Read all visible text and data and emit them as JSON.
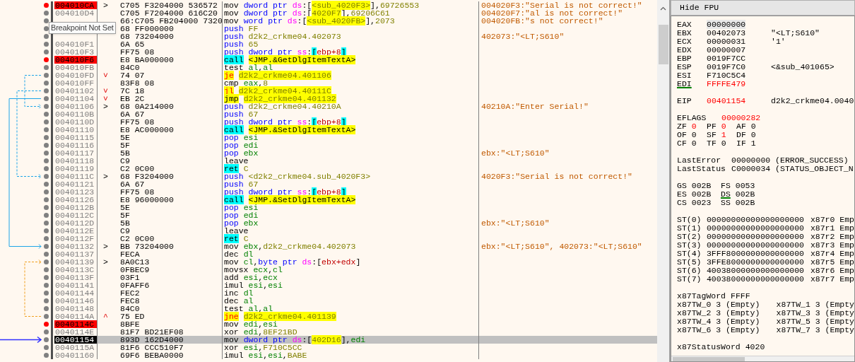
{
  "tooltip": "Breakpoint Not Set",
  "rows": [
    {
      "address": "004010CA",
      "breakpoint": true,
      "current": false,
      "mark": {
        "text": ">",
        "kind": "target"
      },
      "bytes": "C705 F3204000 536572",
      "mnemonic": {
        "text": "mov",
        "kind": "plain"
      },
      "operands": [
        {
          "text": "dword ptr ",
          "kind": "size"
        },
        {
          "text": "ds",
          "kind": "seg"
        },
        {
          "text": ":[",
          "kind": "text"
        },
        {
          "text": "<sub_4020F3>",
          "kind": "labelnum"
        },
        {
          "text": "],",
          "kind": "text"
        },
        {
          "text": "69726553",
          "kind": "num"
        }
      ],
      "comment": "004020F3:\"Serial is not correct!\""
    },
    {
      "address": "004010D4",
      "breakpoint": false,
      "current": false,
      "bytes": "C705 F7204000 616C20",
      "mnemonic": {
        "text": "mov",
        "kind": "plain"
      },
      "operands": [
        {
          "text": "dword ptr ",
          "kind": "size"
        },
        {
          "text": "ds",
          "kind": "seg"
        },
        {
          "text": ":[",
          "kind": "text"
        },
        {
          "text": "4020F7",
          "kind": "labelnum"
        },
        {
          "text": "],",
          "kind": "text"
        },
        {
          "text": "69206C61",
          "kind": "num"
        }
      ],
      "comment": "004020F7:\"al is not correct!\""
    },
    {
      "breakpoint": false,
      "current": false,
      "bytes": "66:C705 FB204000 7320",
      "mnemonic": {
        "text": "mov",
        "kind": "plain"
      },
      "operands": [
        {
          "text": "word ptr ",
          "kind": "size"
        },
        {
          "text": "ds",
          "kind": "seg"
        },
        {
          "text": ":[",
          "kind": "text"
        },
        {
          "text": "<sub_4020FB>",
          "kind": "labelnum"
        },
        {
          "text": "],",
          "kind": "text"
        },
        {
          "text": "2073",
          "kind": "num"
        }
      ],
      "comment": "004020FB:\"s not correct!\""
    },
    {
      "breakpoint": false,
      "current": false,
      "bytes": "68 FF000000",
      "mnemonic": {
        "text": "push",
        "kind": "stack"
      },
      "operands": [
        {
          "text": "FF",
          "kind": "num"
        }
      ]
    },
    {
      "breakpoint": false,
      "current": false,
      "bytes": "68 73204000",
      "mnemonic": {
        "text": "push",
        "kind": "stack"
      },
      "operands": [
        {
          "text": "d2k2_crkme04.402073",
          "kind": "num"
        }
      ],
      "comment": "402073:\"<LT;S610\""
    },
    {
      "address": "004010F1",
      "breakpoint": false,
      "current": false,
      "bytes": "6A 65",
      "mnemonic": {
        "text": "push",
        "kind": "stack"
      },
      "operands": [
        {
          "text": "65",
          "kind": "num"
        }
      ]
    },
    {
      "address": "004010F3",
      "breakpoint": false,
      "current": false,
      "bytes": "FF75 08",
      "mnemonic": {
        "text": "push",
        "kind": "stack"
      },
      "operands": [
        {
          "text": "dword ptr ",
          "kind": "size"
        },
        {
          "text": "ss",
          "kind": "seg"
        },
        {
          "text": ":",
          "kind": "text"
        },
        {
          "text": "[",
          "kind": "hbr"
        },
        {
          "text": "ebp+8",
          "kind": "mem"
        },
        {
          "text": "]",
          "kind": "hbr"
        }
      ]
    },
    {
      "address": "004010F6",
      "breakpoint": true,
      "current": false,
      "bytes": "E8 BA000000",
      "mnemonic": {
        "text": "call",
        "kind": "callret"
      },
      "operands": [
        {
          "text": "<JMP.&GetDlgItemTextA>",
          "kind": "label"
        }
      ]
    },
    {
      "address": "004010FB",
      "breakpoint": false,
      "current": false,
      "bytes": "84C0",
      "mnemonic": {
        "text": "test",
        "kind": "plain"
      },
      "operands": [
        {
          "text": "al",
          "kind": "reg"
        },
        {
          "text": ",",
          "kind": "text"
        },
        {
          "text": "al",
          "kind": "reg"
        }
      ]
    },
    {
      "address": "004010FD",
      "breakpoint": false,
      "current": false,
      "mark": {
        "text": "˅",
        "kind": "jump"
      },
      "bytes": "74 07",
      "mnemonic": {
        "text": "je",
        "kind": "jcc"
      },
      "operands": [
        {
          "text": "d2k2_crkme04.401106",
          "kind": "labelnum"
        }
      ]
    },
    {
      "address": "004010FF",
      "breakpoint": false,
      "current": false,
      "bytes": "83F8 08",
      "mnemonic": {
        "text": "cmp",
        "kind": "plain"
      },
      "operands": [
        {
          "text": "eax",
          "kind": "reg"
        },
        {
          "text": ",",
          "kind": "text"
        },
        {
          "text": "8",
          "kind": "num"
        }
      ]
    },
    {
      "address": "00401102",
      "breakpoint": false,
      "current": false,
      "mark": {
        "text": "˅",
        "kind": "jump"
      },
      "bytes": "7C 18",
      "mnemonic": {
        "text": "jl",
        "kind": "jcc"
      },
      "operands": [
        {
          "text": "d2k2_crkme04.40111C",
          "kind": "labelnum"
        }
      ]
    },
    {
      "address": "00401104",
      "breakpoint": false,
      "current": false,
      "mark": {
        "text": "˅",
        "kind": "jump"
      },
      "bytes": "EB 2C",
      "mnemonic": {
        "text": "jmp",
        "kind": "jmp"
      },
      "operands": [
        {
          "text": "d2k2_crkme04.401132",
          "kind": "labelnum"
        }
      ]
    },
    {
      "address": "00401106",
      "breakpoint": false,
      "current": false,
      "mark": {
        "text": ">",
        "kind": "target"
      },
      "bytes": "68 0A214000",
      "mnemonic": {
        "text": "push",
        "kind": "stack"
      },
      "operands": [
        {
          "text": "d2k2_crkme04.40210A",
          "kind": "num"
        }
      ],
      "comment": "40210A:\"Enter Serial!\""
    },
    {
      "address": "0040110B",
      "breakpoint": false,
      "current": false,
      "bytes": "6A 67",
      "mnemonic": {
        "text": "push",
        "kind": "stack"
      },
      "operands": [
        {
          "text": "67",
          "kind": "num"
        }
      ]
    },
    {
      "address": "0040110D",
      "breakpoint": false,
      "current": false,
      "bytes": "FF75 08",
      "mnemonic": {
        "text": "push",
        "kind": "stack"
      },
      "operands": [
        {
          "text": "dword ptr ",
          "kind": "size"
        },
        {
          "text": "ss",
          "kind": "seg"
        },
        {
          "text": ":",
          "kind": "text"
        },
        {
          "text": "[",
          "kind": "hbr"
        },
        {
          "text": "ebp+8",
          "kind": "mem"
        },
        {
          "text": "]",
          "kind": "hbr"
        }
      ]
    },
    {
      "address": "00401110",
      "breakpoint": false,
      "current": false,
      "bytes": "E8 AC000000",
      "mnemonic": {
        "text": "call",
        "kind": "callret"
      },
      "operands": [
        {
          "text": "<JMP.&SetDlgItemTextA>",
          "kind": "label"
        }
      ]
    },
    {
      "address": "00401115",
      "breakpoint": false,
      "current": false,
      "bytes": "5E",
      "mnemonic": {
        "text": "pop",
        "kind": "stack"
      },
      "operands": [
        {
          "text": "esi",
          "kind": "reg"
        }
      ]
    },
    {
      "address": "00401116",
      "breakpoint": false,
      "current": false,
      "bytes": "5F",
      "mnemonic": {
        "text": "pop",
        "kind": "stack"
      },
      "operands": [
        {
          "text": "edi",
          "kind": "reg"
        }
      ]
    },
    {
      "address": "00401117",
      "breakpoint": false,
      "current": false,
      "bytes": "5B",
      "mnemonic": {
        "text": "pop",
        "kind": "stack"
      },
      "operands": [
        {
          "text": "ebx",
          "kind": "reg"
        }
      ],
      "comment": "ebx:\"<LT;S610\""
    },
    {
      "address": "00401118",
      "breakpoint": false,
      "current": false,
      "bytes": "C9",
      "mnemonic": {
        "text": "leave",
        "kind": "plain"
      },
      "operands": []
    },
    {
      "address": "00401119",
      "breakpoint": false,
      "current": false,
      "bytes": "C2 0C00",
      "mnemonic": {
        "text": "ret",
        "kind": "callret"
      },
      "operands": [
        {
          "text": "C",
          "kind": "num"
        }
      ]
    },
    {
      "address": "0040111C",
      "breakpoint": false,
      "current": false,
      "mark": {
        "text": ">",
        "kind": "target"
      },
      "bytes": "68 F3204000",
      "mnemonic": {
        "text": "push",
        "kind": "stack"
      },
      "operands": [
        {
          "text": "<d2k2_crkme04.sub_4020F3>",
          "kind": "num"
        }
      ],
      "comment": "4020F3:\"Serial is not correct!\""
    },
    {
      "address": "00401121",
      "breakpoint": false,
      "current": false,
      "bytes": "6A 67",
      "mnemonic": {
        "text": "push",
        "kind": "stack"
      },
      "operands": [
        {
          "text": "67",
          "kind": "num"
        }
      ]
    },
    {
      "address": "00401123",
      "breakpoint": false,
      "current": false,
      "bytes": "FF75 08",
      "mnemonic": {
        "text": "push",
        "kind": "stack"
      },
      "operands": [
        {
          "text": "dword ptr ",
          "kind": "size"
        },
        {
          "text": "ss",
          "kind": "seg"
        },
        {
          "text": ":",
          "kind": "text"
        },
        {
          "text": "[",
          "kind": "hbr"
        },
        {
          "text": "ebp+8",
          "kind": "mem"
        },
        {
          "text": "]",
          "kind": "hbr"
        }
      ]
    },
    {
      "address": "00401126",
      "breakpoint": false,
      "current": false,
      "bytes": "E8 96000000",
      "mnemonic": {
        "text": "call",
        "kind": "callret"
      },
      "operands": [
        {
          "text": "<JMP.&SetDlgItemTextA>",
          "kind": "label"
        }
      ]
    },
    {
      "address": "0040112B",
      "breakpoint": false,
      "current": false,
      "bytes": "5E",
      "mnemonic": {
        "text": "pop",
        "kind": "stack"
      },
      "operands": [
        {
          "text": "esi",
          "kind": "reg"
        }
      ]
    },
    {
      "address": "0040112C",
      "breakpoint": false,
      "current": false,
      "bytes": "5F",
      "mnemonic": {
        "text": "pop",
        "kind": "stack"
      },
      "operands": [
        {
          "text": "edi",
          "kind": "reg"
        }
      ]
    },
    {
      "address": "0040112D",
      "breakpoint": false,
      "current": false,
      "bytes": "5B",
      "mnemonic": {
        "text": "pop",
        "kind": "stack"
      },
      "operands": [
        {
          "text": "ebx",
          "kind": "reg"
        }
      ],
      "comment": "ebx:\"<LT;S610\""
    },
    {
      "address": "0040112E",
      "breakpoint": false,
      "current": false,
      "bytes": "C9",
      "mnemonic": {
        "text": "leave",
        "kind": "plain"
      },
      "operands": []
    },
    {
      "address": "0040112F",
      "breakpoint": false,
      "current": false,
      "bytes": "C2 0C00",
      "mnemonic": {
        "text": "ret",
        "kind": "callret"
      },
      "operands": [
        {
          "text": "C",
          "kind": "num"
        }
      ]
    },
    {
      "address": "00401132",
      "breakpoint": false,
      "current": false,
      "mark": {
        "text": ">",
        "kind": "target"
      },
      "bytes": "BB 73204000",
      "mnemonic": {
        "text": "mov",
        "kind": "plain"
      },
      "operands": [
        {
          "text": "ebx",
          "kind": "reg"
        },
        {
          "text": ",",
          "kind": "text"
        },
        {
          "text": "d2k2_crkme04.402073",
          "kind": "num"
        }
      ],
      "comment": "ebx:\"<LT;S610\", 402073:\"<LT;S610\""
    },
    {
      "address": "00401137",
      "breakpoint": false,
      "current": false,
      "bytes": "FECA",
      "mnemonic": {
        "text": "dec",
        "kind": "plain"
      },
      "operands": [
        {
          "text": "dl",
          "kind": "reg"
        }
      ]
    },
    {
      "address": "00401139",
      "breakpoint": false,
      "current": false,
      "mark": {
        "text": ">",
        "kind": "target"
      },
      "bytes": "8A0C13",
      "mnemonic": {
        "text": "mov",
        "kind": "plain"
      },
      "operands": [
        {
          "text": "cl",
          "kind": "reg"
        },
        {
          "text": ",",
          "kind": "text"
        },
        {
          "text": "byte ptr ",
          "kind": "size"
        },
        {
          "text": "ds",
          "kind": "seg"
        },
        {
          "text": ":[",
          "kind": "text"
        },
        {
          "text": "ebx+edx",
          "kind": "mem"
        },
        {
          "text": "]",
          "kind": "text"
        }
      ]
    },
    {
      "address": "0040113C",
      "breakpoint": false,
      "current": false,
      "bytes": "0FBEC9",
      "mnemonic": {
        "text": "movsx",
        "kind": "plain"
      },
      "operands": [
        {
          "text": "ecx",
          "kind": "reg"
        },
        {
          "text": ",",
          "kind": "text"
        },
        {
          "text": "cl",
          "kind": "reg"
        }
      ]
    },
    {
      "address": "0040113F",
      "breakpoint": false,
      "current": false,
      "bytes": "03F1",
      "mnemonic": {
        "text": "add",
        "kind": "plain"
      },
      "operands": [
        {
          "text": "esi",
          "kind": "reg"
        },
        {
          "text": ",",
          "kind": "text"
        },
        {
          "text": "ecx",
          "kind": "reg"
        }
      ]
    },
    {
      "address": "00401141",
      "breakpoint": false,
      "current": false,
      "bytes": "0FAFF6",
      "mnemonic": {
        "text": "imul",
        "kind": "plain"
      },
      "operands": [
        {
          "text": "esi",
          "kind": "reg"
        },
        {
          "text": ",",
          "kind": "text"
        },
        {
          "text": "esi",
          "kind": "reg"
        }
      ]
    },
    {
      "address": "00401144",
      "breakpoint": false,
      "current": false,
      "bytes": "FEC2",
      "mnemonic": {
        "text": "inc",
        "kind": "plain"
      },
      "operands": [
        {
          "text": "dl",
          "kind": "reg"
        }
      ]
    },
    {
      "address": "00401146",
      "breakpoint": false,
      "current": false,
      "bytes": "FEC8",
      "mnemonic": {
        "text": "dec",
        "kind": "plain"
      },
      "operands": [
        {
          "text": "al",
          "kind": "reg"
        }
      ]
    },
    {
      "address": "00401148",
      "breakpoint": false,
      "current": false,
      "bytes": "84C0",
      "mnemonic": {
        "text": "test",
        "kind": "plain"
      },
      "operands": [
        {
          "text": "al",
          "kind": "reg"
        },
        {
          "text": ",",
          "kind": "text"
        },
        {
          "text": "al",
          "kind": "reg"
        }
      ]
    },
    {
      "address": "0040114A",
      "breakpoint": false,
      "current": false,
      "mark": {
        "text": "^",
        "kind": "jump"
      },
      "bytes": "75 ED",
      "mnemonic": {
        "text": "jne",
        "kind": "jcc"
      },
      "operands": [
        {
          "text": "d2k2_crkme04.401139",
          "kind": "labelnum"
        }
      ]
    },
    {
      "address": "0040114C",
      "breakpoint": true,
      "current": false,
      "bytes": "8BFE",
      "mnemonic": {
        "text": "mov",
        "kind": "plain"
      },
      "operands": [
        {
          "text": "edi",
          "kind": "reg"
        },
        {
          "text": ",",
          "kind": "text"
        },
        {
          "text": "esi",
          "kind": "reg"
        }
      ]
    },
    {
      "address": "0040114E",
      "breakpoint": false,
      "current": false,
      "bytes": "81F7 BD21EF08",
      "mnemonic": {
        "text": "xor",
        "kind": "plain"
      },
      "operands": [
        {
          "text": "edi",
          "kind": "reg"
        },
        {
          "text": ",",
          "kind": "text"
        },
        {
          "text": "8EF21BD",
          "kind": "num"
        }
      ]
    },
    {
      "address": "00401154",
      "breakpoint": false,
      "current": true,
      "bytes": "893D 162D4000",
      "mnemonic": {
        "text": "mov",
        "kind": "plain"
      },
      "operands": [
        {
          "text": "dword ptr ",
          "kind": "size"
        },
        {
          "text": "ds",
          "kind": "seg"
        },
        {
          "text": ":[",
          "kind": "text"
        },
        {
          "text": "402D16",
          "kind": "labelnum"
        },
        {
          "text": "],",
          "kind": "text"
        },
        {
          "text": "edi",
          "kind": "reg"
        }
      ]
    },
    {
      "address": "0040115A",
      "breakpoint": false,
      "current": false,
      "bytes": "81F6 CCC510F7",
      "mnemonic": {
        "text": "xor",
        "kind": "plain"
      },
      "operands": [
        {
          "text": "esi",
          "kind": "reg"
        },
        {
          "text": ",",
          "kind": "text"
        },
        {
          "text": "F710C5CC",
          "kind": "num"
        }
      ]
    },
    {
      "address": "00401160",
      "breakpoint": false,
      "current": false,
      "bytes": "69F6 BEBA0000",
      "mnemonic": {
        "text": "imul",
        "kind": "plain"
      },
      "operands": [
        {
          "text": "esi",
          "kind": "reg"
        },
        {
          "text": ",",
          "kind": "text"
        },
        {
          "text": "esi",
          "kind": "reg"
        },
        {
          "text": ",",
          "kind": "text"
        },
        {
          "text": "BABE",
          "kind": "num"
        }
      ]
    }
  ],
  "fpu_panel": {
    "toggle_button": "Hide FPU",
    "registers": [
      {
        "name": "EAX",
        "value": "00000000",
        "changed": false,
        "used": false,
        "selected": true
      },
      {
        "name": "EBX",
        "value": "00402073",
        "changed": false,
        "used": false,
        "selected": false,
        "comment": "\"<LT;S610\""
      },
      {
        "name": "ECX",
        "value": "00000031",
        "changed": false,
        "used": false,
        "selected": false,
        "comment": "'1'"
      },
      {
        "name": "EDX",
        "value": "00000007",
        "changed": false,
        "used": false,
        "selected": false
      },
      {
        "name": "EBP",
        "value": "0019F7CC",
        "changed": false,
        "used": false,
        "selected": false
      },
      {
        "name": "ESP",
        "value": "0019F7C0",
        "changed": false,
        "used": false,
        "selected": false,
        "comment": "<&sub_401065>"
      },
      {
        "name": "ESI",
        "value": "F710C5C4",
        "changed": false,
        "used": false,
        "selected": false
      },
      {
        "name": "EDI",
        "value": "FFFFE479",
        "changed": true,
        "used": true,
        "selected": false
      }
    ],
    "eip": {
      "name": "EIP",
      "value": "00401154",
      "changed": true,
      "comment": "d2k2_crkme04.0040"
    },
    "eflags": {
      "name": "EFLAGS",
      "value": "00000282",
      "changed": true
    },
    "flags": [
      [
        {
          "name": "ZF",
          "value": "0",
          "changed": true
        },
        {
          "name": "PF",
          "value": "0",
          "changed": true
        },
        {
          "name": "AF",
          "value": "0",
          "changed": false
        }
      ],
      [
        {
          "name": "OF",
          "value": "0",
          "changed": false
        },
        {
          "name": "SF",
          "value": "1",
          "changed": true
        },
        {
          "name": "DF",
          "value": "0",
          "changed": false
        }
      ],
      [
        {
          "name": "CF",
          "value": "0",
          "changed": false
        },
        {
          "name": "TF",
          "value": "0",
          "changed": false
        },
        {
          "name": "IF",
          "value": "1",
          "changed": false
        }
      ]
    ],
    "last": [
      {
        "name": "LastError",
        "value": "00000000 (ERROR_SUCCESS)"
      },
      {
        "name": "LastStatus",
        "value": "C0000034 (STATUS_OBJECT_N"
      }
    ],
    "segments": [
      [
        {
          "name": "GS",
          "value": "002B",
          "used": false
        },
        {
          "name": "FS",
          "value": "0053",
          "used": false
        }
      ],
      [
        {
          "name": "ES",
          "value": "002B",
          "used": false
        },
        {
          "name": "DS",
          "value": "002B",
          "used": true
        }
      ],
      [
        {
          "name": "CS",
          "value": "0023",
          "used": false
        },
        {
          "name": "SS",
          "value": "002B",
          "used": false
        }
      ]
    ],
    "x87_registers": [
      {
        "name": "ST(0)",
        "value": "00000000000000000000",
        "tag": "x87r0 Emp"
      },
      {
        "name": "ST(1)",
        "value": "00000000000000000000",
        "tag": "x87r1 Emp"
      },
      {
        "name": "ST(2)",
        "value": "00000000000000000000",
        "tag": "x87r2 Emp"
      },
      {
        "name": "ST(3)",
        "value": "00000000000000000000",
        "tag": "x87r3 Emp"
      },
      {
        "name": "ST(4)",
        "value": "3FFF8000000000000000",
        "tag": "x87r4 Emp"
      },
      {
        "name": "ST(5)",
        "value": "3FFE8000000000000000",
        "tag": "x87r5 Emp"
      },
      {
        "name": "ST(6)",
        "value": "40038000000000000000",
        "tag": "x87r6 Emp"
      },
      {
        "name": "ST(7)",
        "value": "40038000000000000000",
        "tag": "x87r7 Emp"
      }
    ],
    "tag_word": {
      "name": "x87TagWord",
      "value": "FFFF"
    },
    "tag_words": [
      [
        "x87TW_0 3 (Empty)",
        "x87TW_1 3 (Empty"
      ],
      [
        "x87TW_2 3 (Empty)",
        "x87TW_3 3 (Empty"
      ],
      [
        "x87TW_4 3 (Empty)",
        "x87TW_5 3 (Empty"
      ],
      [
        "x87TW_6 3 (Empty)",
        "x87TW_7 3 (Empty"
      ]
    ],
    "status_word": {
      "name": "x87StatusWord",
      "value": "4020"
    }
  }
}
